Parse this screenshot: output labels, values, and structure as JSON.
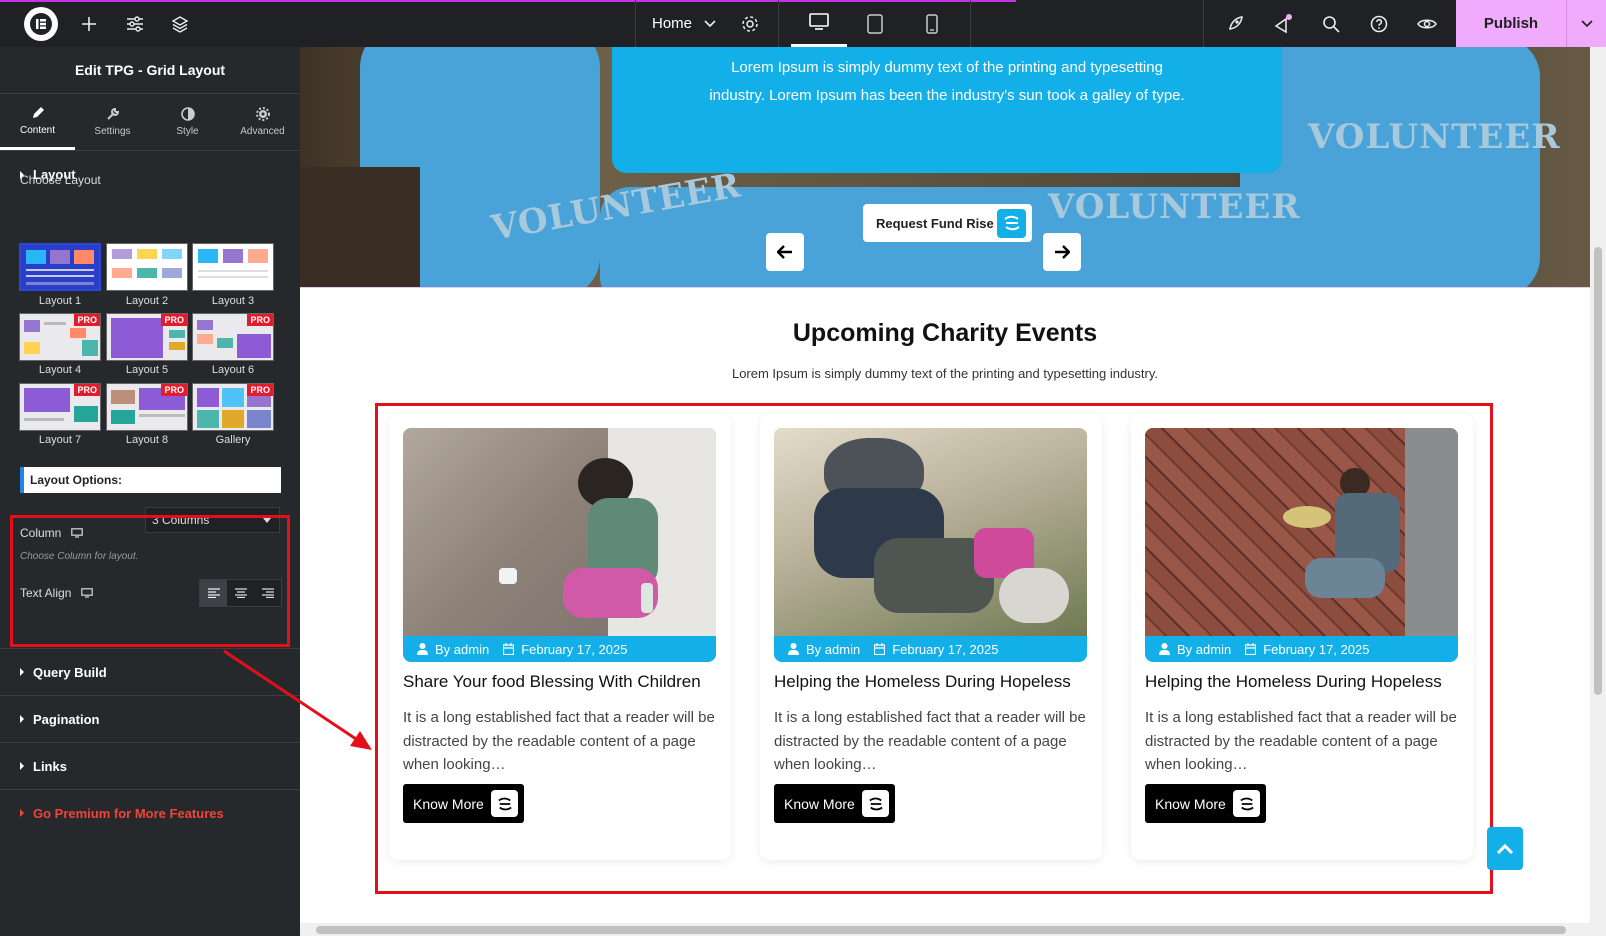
{
  "topbar": {
    "page_name": "Home",
    "publish_label": "Publish"
  },
  "panel": {
    "title": "Edit TPG - Grid Layout",
    "tabs": [
      {
        "label": "Content",
        "icon": "pencil-icon",
        "active": true
      },
      {
        "label": "Settings",
        "icon": "wrench-icon"
      },
      {
        "label": "Style",
        "icon": "half-circle-icon"
      },
      {
        "label": "Advanced",
        "icon": "gear-icon"
      }
    ],
    "layout_section": "Layout",
    "choose_layout_label": "Choose Layout",
    "layouts": [
      {
        "label": "Layout 1",
        "pro": false,
        "selected": true
      },
      {
        "label": "Layout 2",
        "pro": false
      },
      {
        "label": "Layout 3",
        "pro": false
      },
      {
        "label": "Layout 4",
        "pro": true
      },
      {
        "label": "Layout 5",
        "pro": true
      },
      {
        "label": "Layout 6",
        "pro": true
      },
      {
        "label": "Layout 7",
        "pro": true
      },
      {
        "label": "Layout 8",
        "pro": true
      },
      {
        "label": "Gallery",
        "pro": true
      }
    ],
    "pro_label": "PRO",
    "layout_options_label": "Layout Options:",
    "column_label": "Column",
    "column_value": "3 Columns",
    "column_help": "Choose Column for layout.",
    "text_align_label": "Text Align",
    "sections": [
      "Query Build",
      "Pagination",
      "Links"
    ],
    "premium_label": "Go Premium for More Features"
  },
  "hero": {
    "text_line1": "Lorem Ipsum is simply dummy text of the printing and typesetting",
    "text_line2": "industry. Lorem Ipsum has been the industry's sun took a galley of type.",
    "fund_button": "Request Fund Rise",
    "shirt_text": "VOLUNTEER"
  },
  "events": {
    "title": "Upcoming Charity Events",
    "subtitle": "Lorem Ipsum is simply dummy text of the printing and typesetting industry.",
    "cards": [
      {
        "author": "By admin",
        "date": "February 17, 2025",
        "title": "Share Your food Blessing With Children",
        "excerpt": "It is a long established fact that a reader will be distracted by the readable content of a page when looking…",
        "button": "Know More"
      },
      {
        "author": "By admin",
        "date": "February 17, 2025",
        "title": "Helping the Homeless During Hopeless",
        "excerpt": "It is a long established fact that a reader will be distracted by the readable content of a page when looking…",
        "button": "Know More"
      },
      {
        "author": "By admin",
        "date": "February 17, 2025",
        "title": "Helping the Homeless During Hopeless",
        "excerpt": "It is a long established fact that a reader will be distracted by the readable content of a page when looking…",
        "button": "Know More"
      }
    ]
  },
  "colors": {
    "accent": "#12afe8",
    "publish": "#f0abfc",
    "highlight": "#e3101a",
    "panel_bg": "#26292c"
  }
}
